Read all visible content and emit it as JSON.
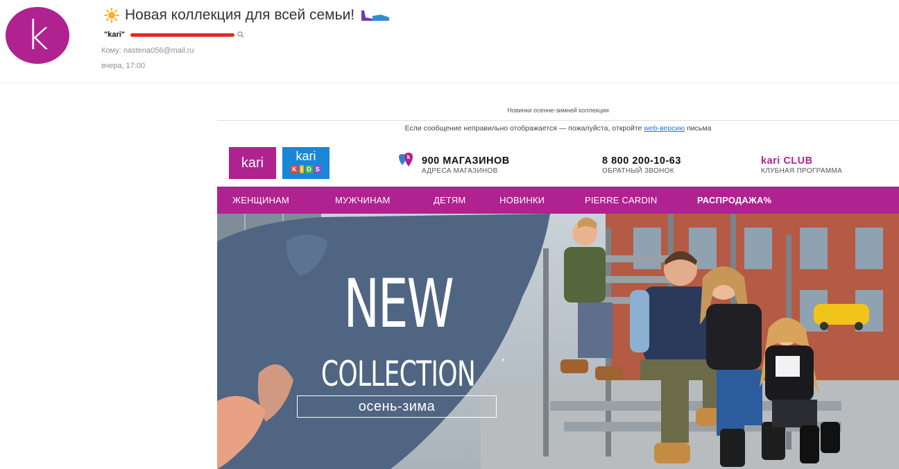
{
  "mail": {
    "avatar_letter": "k",
    "subject": "Новая коллекция для всей семьи!",
    "sender": "\"kari\"",
    "to": "Кому: nastena056@mail.ru",
    "date": "вчера, 17:00"
  },
  "email": {
    "preheader": "Новинки осенне-зимней коллекции",
    "web_text_before": "Если сообщение неправильно отображается — пожалуйста, откройте",
    "web_link": "web-версию",
    "web_text_after": "письма",
    "logo_kari": "kari",
    "logo_kids_top": "kari",
    "logo_kids_letters": [
      "K",
      "I",
      "D",
      "S"
    ],
    "stores": {
      "title": "900 МАГАЗИНОВ",
      "subtitle": "АДРЕСА МАГАЗИНОВ"
    },
    "phone": {
      "title": "8 800 200-10-63",
      "subtitle": "ОБРАТНЫЙ ЗВОНОК"
    },
    "club": {
      "title": "kari CLUB",
      "subtitle": "КЛУБНАЯ ПРОГРАММА"
    },
    "nav": [
      "ЖЕНЩИНАМ",
      "МУЖЧИНАМ",
      "ДЕТЯМ",
      "НОВИНКИ",
      "PIERRE CARDIN",
      "РАСПРОДАЖА%"
    ],
    "hero": {
      "line1": "NEW",
      "line2": "COLLECTION",
      "star": "*",
      "season": "осень-зима"
    }
  },
  "colors": {
    "brand": "#b0228f",
    "kids_blue": "#1a86d8",
    "hero_panel": "#4f6582",
    "hero_accent": "#e8a183"
  }
}
